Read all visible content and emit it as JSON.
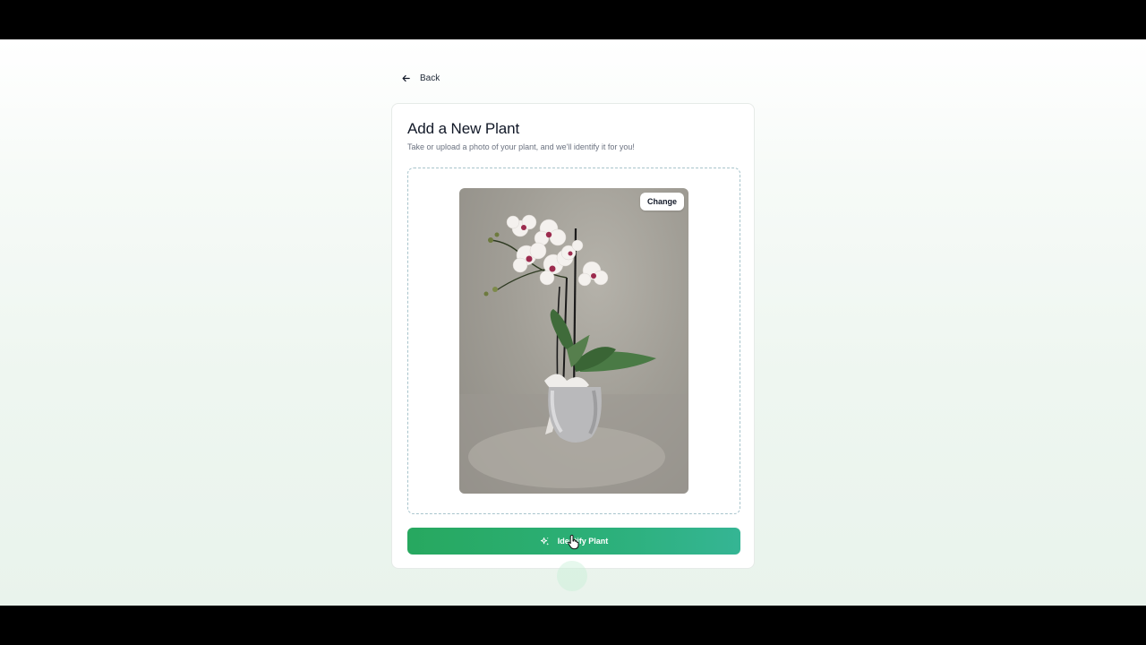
{
  "nav": {
    "back_label": "Back"
  },
  "card": {
    "title": "Add a New Plant",
    "subtitle": "Take or upload a photo of your plant, and we'll identify it for you!"
  },
  "upload": {
    "change_label": "Change",
    "photo_subject": "orchid-photo"
  },
  "actions": {
    "identify_label": "Identify Plant"
  },
  "icons": {
    "back": "arrow-left-icon",
    "identify": "sparkles-icon",
    "cursor": "hand-pointer-icon"
  },
  "colors": {
    "accent_start": "#27a85f",
    "accent_end": "#35b594",
    "dropzone_border": "#a8c4cc"
  }
}
